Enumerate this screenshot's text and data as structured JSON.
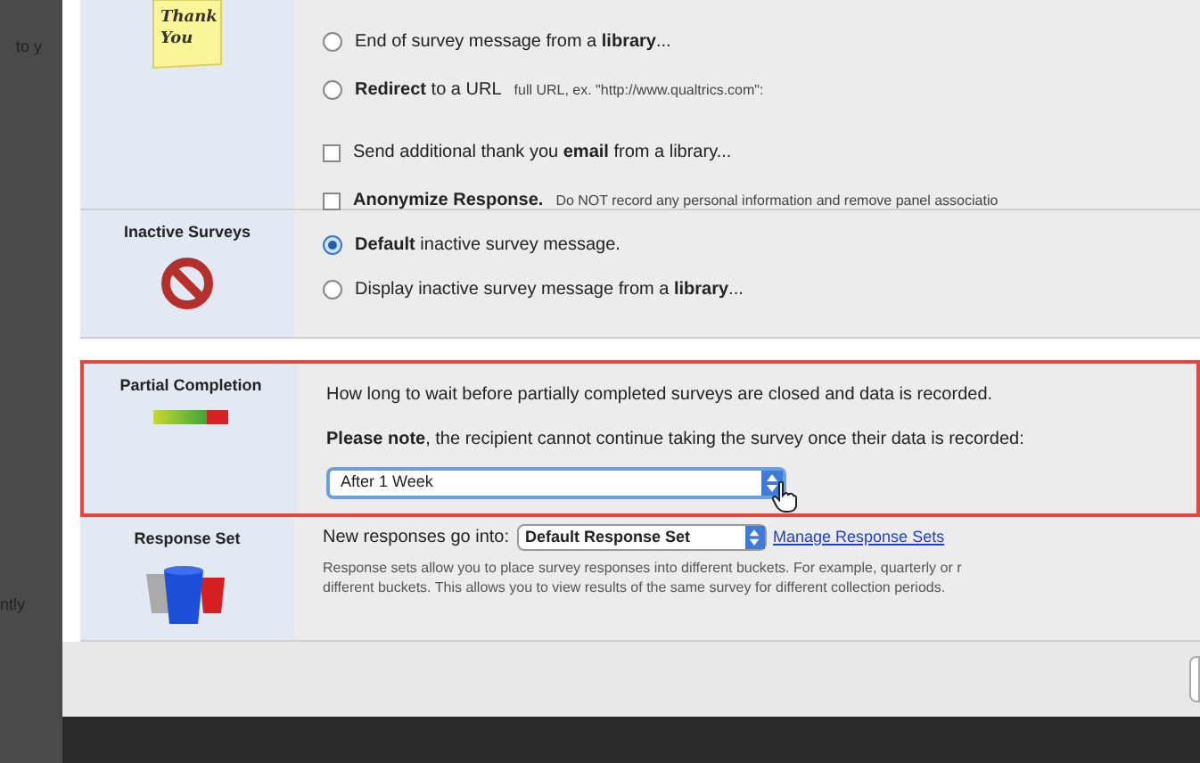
{
  "background_texts": [
    "to y",
    "ntly"
  ],
  "thank_you": {
    "note_text": "Thank You",
    "options": [
      {
        "kind": "radio",
        "selected": false,
        "text": "End of survey message from a **library**..."
      },
      {
        "kind": "radio",
        "selected": false,
        "text": "**Redirect** to a URL",
        "hint": "full URL, ex. \"http://www.qualtrics.com\":"
      },
      {
        "kind": "checkbox",
        "checked": false,
        "text": "Send additional thank you **email** from a library..."
      },
      {
        "kind": "checkbox",
        "checked": false,
        "text": "**Anonymize Response.**",
        "hint": "Do NOT record any personal information and remove panel associatio"
      }
    ]
  },
  "inactive": {
    "title": "Inactive Surveys",
    "options": [
      {
        "kind": "radio",
        "selected": true,
        "text": "**Default** inactive survey message."
      },
      {
        "kind": "radio",
        "selected": false,
        "text": "Display inactive survey message from a **library**..."
      }
    ]
  },
  "partial": {
    "title": "Partial Completion",
    "highlighted": true,
    "description": "How long to wait before partially completed surveys are closed and data is recorded.",
    "note": "**Please note**, the recipient cannot continue taking the survey once their data is recorded:",
    "select": "After 1 Week"
  },
  "response_set": {
    "title": "Response Set",
    "label": "New responses go into:",
    "select": "Default Response Set",
    "link": "Manage Response Sets",
    "description": [
      "Response sets allow you to place survey responses into different buckets. For example, quarterly or r",
      "different buckets. This allows you to view results of the same survey for different collection periods."
    ]
  }
}
